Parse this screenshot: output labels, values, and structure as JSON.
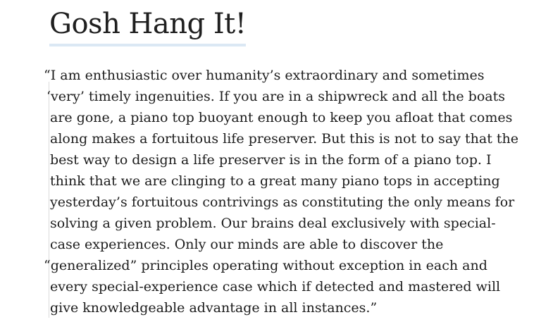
{
  "article": {
    "title": "Gosh Hang It!",
    "quote_lines": [
      "“I am enthusiastic over humanity’s extraordinary and sometimes",
      "‘very’ timely ingenuities. If you are in a shipwreck and all the boats",
      "are gone, a piano top buoyant enough to keep you afloat that comes",
      "along makes a fortuitous life preserver. But this is not to say that the",
      "best way to design a life preserver is in the form of a piano top. I",
      "think that we are clinging to a great many piano tops in accepting",
      "yesterday’s fortuitous contrivings as constituting the only means for",
      "solving a given problem. Our brains deal exclusively with special-",
      "case experiences. Only our minds are able to discover the",
      "“generalized” principles operating without exception in each and",
      "every special-experience case which if detected and mastered will",
      "give knowledgeable advantage in all instances.”"
    ]
  },
  "colors": {
    "title_underline": "#dbe8f4",
    "text": "#1c1c1c",
    "quote_rule": "#d9d9d9"
  }
}
